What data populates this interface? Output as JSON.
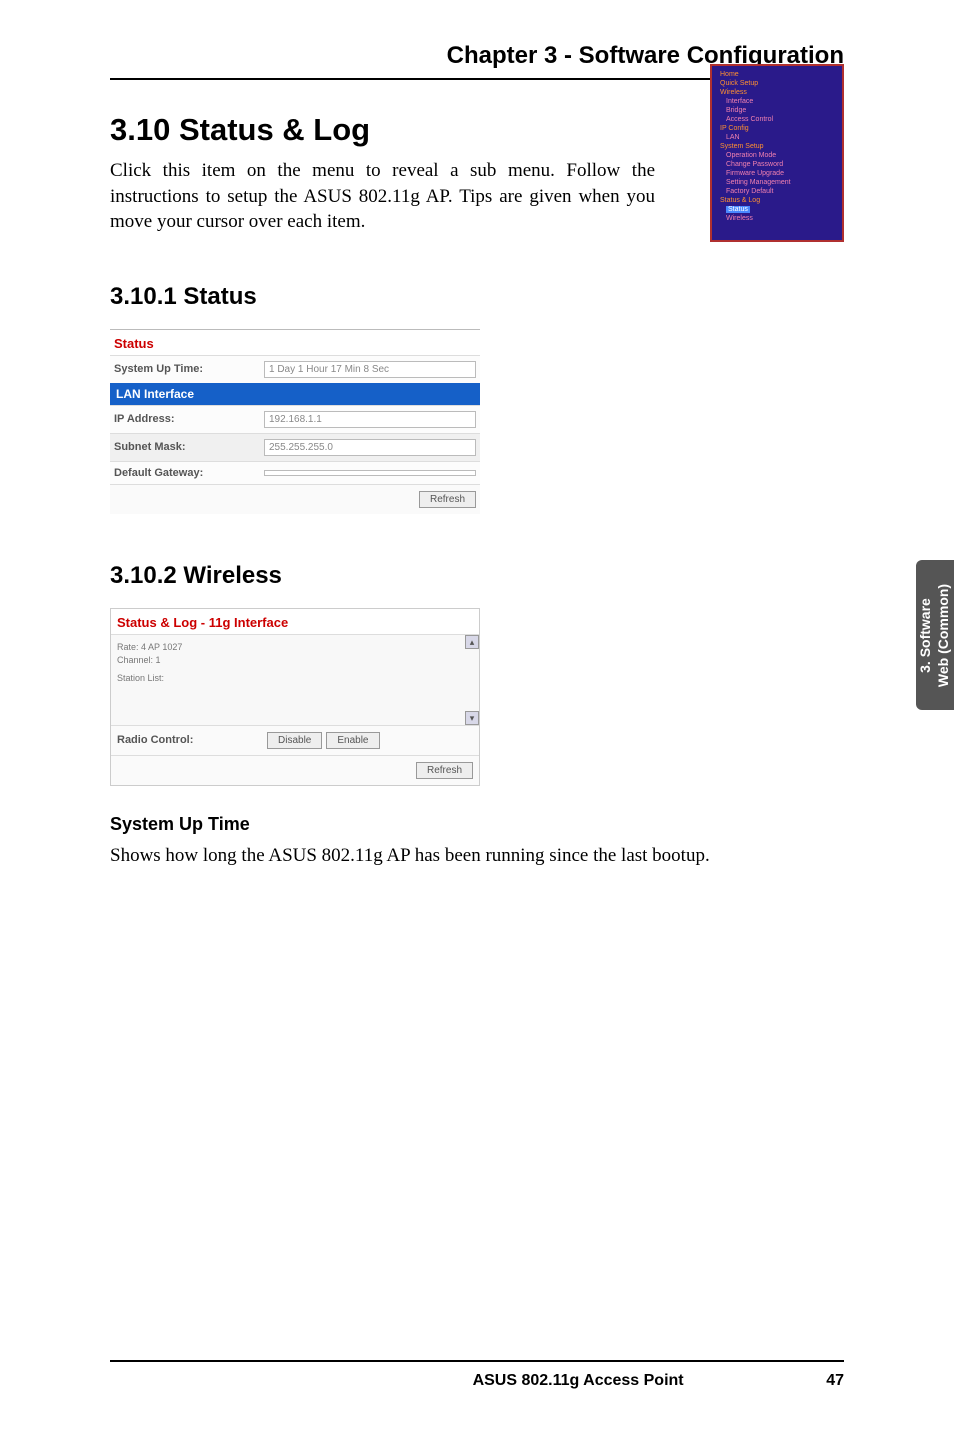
{
  "chapter_heading": "Chapter 3 - Software Configuration",
  "section_heading": "3.10  Status & Log",
  "intro_text": "Click this item on the menu to reveal a sub menu. Follow the instructions to setup the ASUS 802.11g AP. Tips are given when you move your cursor over each item.",
  "nav_menu": {
    "items": [
      "Home",
      "Quick Setup",
      "Wireless",
      "Interface",
      "Bridge",
      "Access Control",
      "IP Config",
      "LAN",
      "System Setup",
      "Operation Mode",
      "Change Password",
      "Firmware Upgrade",
      "Setting Management",
      "Factory Default",
      "Status & Log",
      "Status",
      "Wireless"
    ]
  },
  "subsection1_heading": "3.10.1  Status",
  "status_panel": {
    "title": "Status",
    "row_uptime_label": "System Up Time:",
    "row_uptime_value": "1 Day   1 Hour   17 Min   8 Sec",
    "section_lan": "LAN Interface",
    "row_ip_label": "IP Address:",
    "row_ip_value": "192.168.1.1",
    "row_mask_label": "Subnet Mask:",
    "row_mask_value": "255.255.255.0",
    "row_gw_label": "Default Gateway:",
    "row_gw_value": "",
    "refresh_btn": "Refresh"
  },
  "subsection2_heading": "3.10.2  Wireless",
  "wireless_panel": {
    "title": "Status & Log - 11g Interface",
    "log_text_line1": "Rate:      4 AP 1027",
    "log_text_line2": "Channel: 1",
    "log_text_line3": "Station List:",
    "radio_label": "Radio Control:",
    "disable_btn": "Disable",
    "enable_btn": "Enable",
    "refresh_btn": "Refresh"
  },
  "para_heading": "System Up Time",
  "body_para": "Shows how long the ASUS 802.11g AP has been running since the last bootup.",
  "side_tab_line1": "3. Software",
  "side_tab_line2": "Web (Common)",
  "footer_product": "ASUS 802.11g Access Point",
  "footer_page": "47"
}
